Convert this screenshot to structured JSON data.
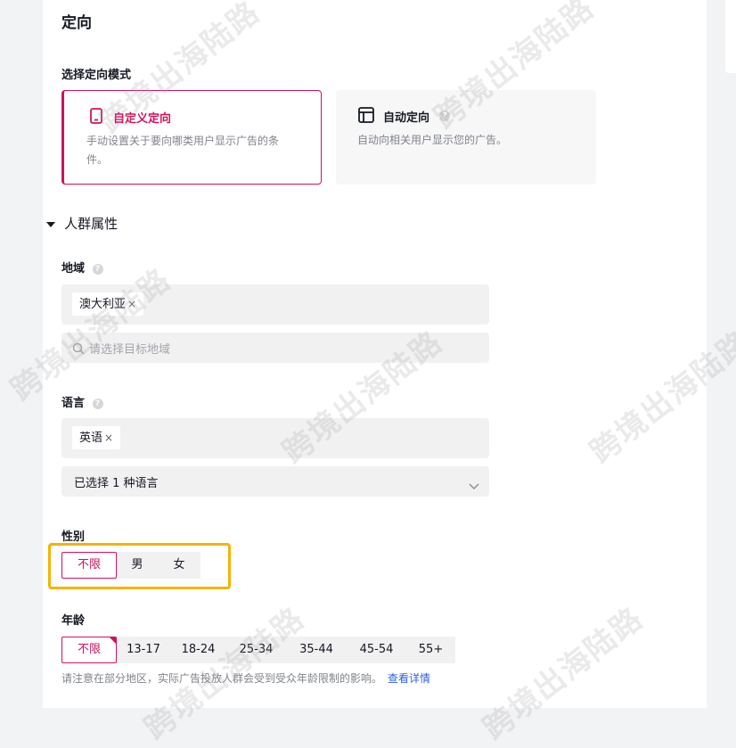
{
  "section_title": "定向",
  "mode": {
    "label": "选择定向模式",
    "options": [
      {
        "title": "自定义定向",
        "desc": "手动设置关于要向哪类用户显示广告的条件。",
        "icon": "mobile-icon",
        "selected": true
      },
      {
        "title": "自动定向",
        "desc": "自动向相关用户显示您的广告。",
        "icon": "layout-icon",
        "selected": false
      }
    ]
  },
  "audience": {
    "title": "人群属性",
    "region": {
      "label": "地域",
      "tag": "澳大利亚",
      "placeholder": "请选择目标地域"
    },
    "language": {
      "label": "语言",
      "tag": "英语",
      "select_value": "已选择 1 种语言"
    },
    "gender": {
      "label": "性别",
      "options": [
        "不限",
        "男",
        "女"
      ],
      "selected": "不限"
    },
    "age": {
      "label": "年龄",
      "options": [
        "不限",
        "13-17",
        "18-24",
        "25-34",
        "35-44",
        "45-54",
        "55+"
      ],
      "selected": "不限",
      "note": "请注意在部分地区，实际广告投放人群会受到受众年龄限制的影响。",
      "link": "查看详情"
    }
  },
  "watermark": "跨境出海陆路",
  "colors": {
    "accent": "#d0115f",
    "highlight": "#f5b301",
    "link": "#2f62d9"
  }
}
